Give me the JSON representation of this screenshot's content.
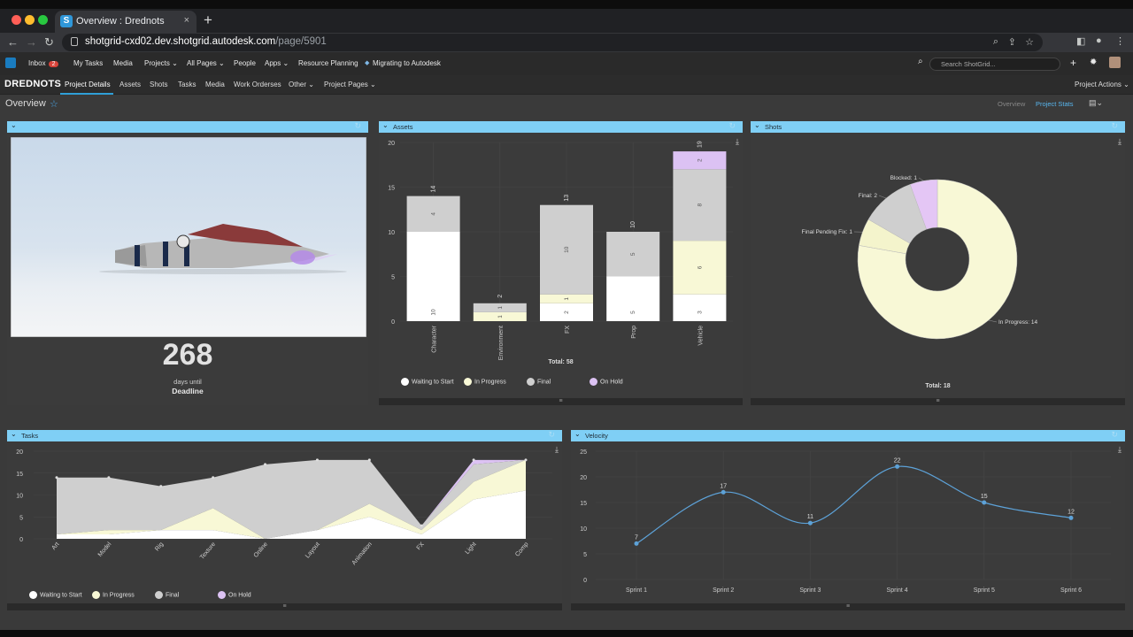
{
  "browser": {
    "tab_title": "Overview : Drednots",
    "url_host": "shotgrid-cxd02.dev.shotgrid.",
    "url_domain": "autodesk.com",
    "url_path": "/page/5901",
    "newtab": "+",
    "tab_close": "×"
  },
  "app_nav": {
    "items": [
      "Inbox",
      "My Tasks",
      "Media",
      "Projects ⌄",
      "All Pages ⌄",
      "People",
      "Apps ⌄",
      "Resource Planning",
      "Migrating to Autodesk"
    ],
    "inbox_count": "2",
    "search_placeholder": "Search ShotGrid..."
  },
  "project_nav": {
    "project": "DREDNOTS",
    "tabs": [
      "Project Details",
      "Assets",
      "Shots",
      "Tasks",
      "Media",
      "Work Orderses",
      "Other ⌄",
      "Project Pages ⌄"
    ],
    "actions": "Project Actions ⌄"
  },
  "page": {
    "title": "Overview",
    "links": [
      "Overview",
      "Project Stats"
    ]
  },
  "countdown": {
    "value": "268",
    "label": "days until",
    "deadline": "Deadline"
  },
  "colors": {
    "waiting": "#ffffff",
    "in_progress": "#f8f8d6",
    "final": "#cfcfcf",
    "on_hold": "#dcc2f3",
    "velocity": "#5da2d8",
    "header": "#7fcff5"
  },
  "legend": [
    "Waiting to Start",
    "In Progress",
    "Final",
    "On Hold"
  ],
  "assets": {
    "title": "Assets",
    "total": "Total: 58"
  },
  "shots": {
    "title": "Shots",
    "total": "Total: 18"
  },
  "tasks": {
    "title": "Tasks"
  },
  "velocity": {
    "title": "Velocity"
  },
  "chart_data": [
    {
      "type": "bar",
      "name": "Assets",
      "categories": [
        "Character",
        "Environment",
        "FX",
        "Prop",
        "Vehicle"
      ],
      "series": [
        {
          "name": "Waiting to Start",
          "values": [
            10,
            0,
            2,
            5,
            3
          ]
        },
        {
          "name": "In Progress",
          "values": [
            0,
            1,
            1,
            0,
            6
          ]
        },
        {
          "name": "Final",
          "values": [
            4,
            1,
            10,
            5,
            8
          ]
        },
        {
          "name": "On Hold",
          "values": [
            0,
            0,
            0,
            0,
            2
          ]
        }
      ],
      "totals": [
        14,
        2,
        13,
        10,
        19
      ],
      "ylim": [
        0,
        20
      ],
      "yticks": [
        0,
        5,
        10,
        15,
        20
      ],
      "total": "Total: 58"
    },
    {
      "type": "pie",
      "name": "Shots",
      "labels": [
        "In Progress: 14",
        "Final Pending Fix: 1",
        "Final: 2",
        "Blocked: 1"
      ],
      "values": [
        14,
        1,
        2,
        1
      ],
      "colors": [
        "#f8f8d6",
        "#f4f4cc",
        "#cfcfcf",
        "#e4c6f5"
      ],
      "total": "Total: 18"
    },
    {
      "type": "area",
      "name": "Tasks",
      "categories": [
        "Art",
        "Model",
        "Rig",
        "Texture",
        "Online",
        "Layout",
        "Animation",
        "FX",
        "Light",
        "Comp"
      ],
      "series": [
        {
          "name": "Waiting to Start",
          "values": [
            1,
            1,
            2,
            2,
            0,
            2,
            5,
            1,
            9,
            11
          ]
        },
        {
          "name": "In Progress",
          "values": [
            0,
            1,
            0,
            5,
            0,
            0,
            3,
            1,
            4,
            7
          ]
        },
        {
          "name": "Final",
          "values": [
            13,
            12,
            10,
            7,
            17,
            16,
            10,
            1,
            4,
            0
          ]
        },
        {
          "name": "On Hold",
          "values": [
            0,
            0,
            0,
            0,
            0,
            0,
            0,
            0,
            1,
            0
          ]
        }
      ],
      "ylim": [
        0,
        20
      ],
      "yticks": [
        0,
        5,
        10,
        15,
        20
      ]
    },
    {
      "type": "line",
      "name": "Velocity",
      "categories": [
        "Sprint 1",
        "Sprint 2",
        "Sprint 3",
        "Sprint 4",
        "Sprint 5",
        "Sprint 6"
      ],
      "values": [
        7,
        17,
        11,
        22,
        15,
        12
      ],
      "ylim": [
        0,
        25
      ],
      "yticks": [
        0,
        5,
        10,
        15,
        20,
        25
      ]
    }
  ]
}
